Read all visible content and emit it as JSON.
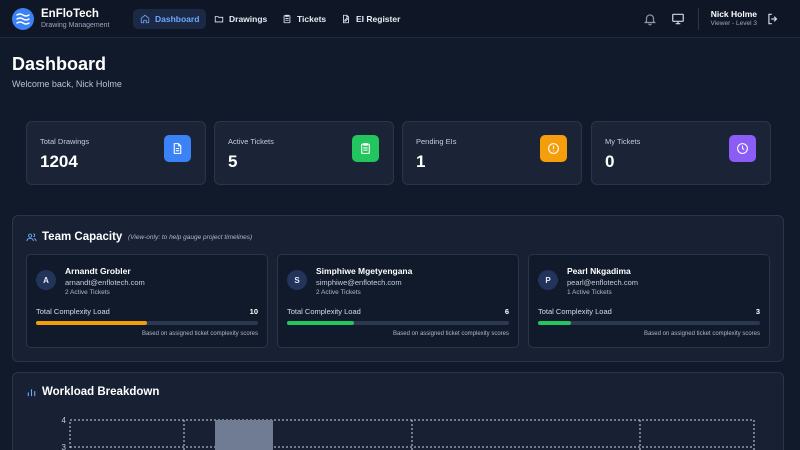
{
  "app": {
    "name": "EnFloTech",
    "subtitle": "Drawing Management"
  },
  "nav": {
    "items": [
      {
        "label": "Dashboard",
        "icon": "home-icon",
        "active": true
      },
      {
        "label": "Drawings",
        "icon": "folder-icon",
        "active": false
      },
      {
        "label": "Tickets",
        "icon": "clipboard-icon",
        "active": false
      },
      {
        "label": "EI Register",
        "icon": "file-edit-icon",
        "active": false
      }
    ]
  },
  "user": {
    "name": "Nick Holme",
    "role": "Viewer - Level 3"
  },
  "page": {
    "title": "Dashboard",
    "welcome": "Welcome back, Nick Holme"
  },
  "stats": [
    {
      "label": "Total Drawings",
      "value": "1204",
      "icon": "document-icon",
      "color": "#3b82f6"
    },
    {
      "label": "Active Tickets",
      "value": "5",
      "icon": "clipboard-list-icon",
      "color": "#22c55e"
    },
    {
      "label": "Pending EIs",
      "value": "1",
      "icon": "alert-circle-icon",
      "color": "#f59e0b"
    },
    {
      "label": "My Tickets",
      "value": "0",
      "icon": "clock-icon",
      "color": "#8b5cf6"
    }
  ],
  "team": {
    "title": "Team Capacity",
    "note": "(View-only: to help gauge project timelines)",
    "load_label": "Total Complexity Load",
    "load_note": "Based on assigned ticket complexity scores",
    "members": [
      {
        "initial": "A",
        "name": "Arnandt Grobler",
        "email": "arnandt@enflotech.com",
        "tickets": "2 Active Tickets",
        "load": "10",
        "load_fraction": 0.5,
        "bar_color": "#f59e0b"
      },
      {
        "initial": "S",
        "name": "Simphiwe Mgetyengana",
        "email": "simphiwe@enflotech.com",
        "tickets": "2 Active Tickets",
        "load": "6",
        "load_fraction": 0.3,
        "bar_color": "#22c55e"
      },
      {
        "initial": "P",
        "name": "Pearl Nkgadima",
        "email": "pearl@enflotech.com",
        "tickets": "1 Active Tickets",
        "load": "3",
        "load_fraction": 0.15,
        "bar_color": "#22c55e"
      }
    ]
  },
  "workload": {
    "title": "Workload Breakdown",
    "y_ticks": [
      "4",
      "3"
    ]
  },
  "chart_data": {
    "type": "bar",
    "title": "Workload Breakdown",
    "y_ticks": [
      4,
      3
    ],
    "bars": [
      {
        "value": 4
      }
    ],
    "grid": true
  }
}
